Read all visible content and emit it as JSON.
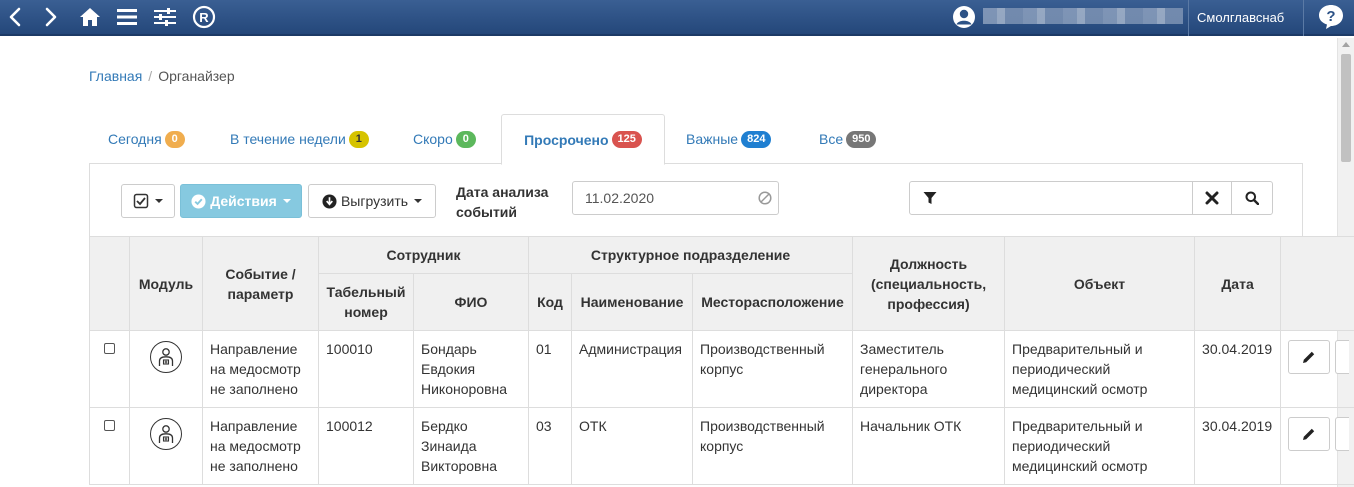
{
  "topbar": {
    "icons": [
      "back-arrow-icon",
      "forward-arrow-icon",
      "home-icon",
      "menu-icon",
      "settings-sliders-icon",
      "registered-icon",
      "user-icon",
      "help-icon"
    ],
    "org_name": "Смолглавснаб",
    "help_label": "?"
  },
  "breadcrumb": {
    "home": "Главная",
    "separator": "/",
    "current": "Органайзер"
  },
  "tabs": [
    {
      "label": "Сегодня",
      "count": "0",
      "color": "#f0ad4e"
    },
    {
      "label": "В течение недели",
      "count": "1",
      "color": "#d6c300"
    },
    {
      "label": "Скоро",
      "count": "0",
      "color": "#5cb85c"
    },
    {
      "label": "Просрочено",
      "count": "125",
      "color": "#d9534f",
      "active": true
    },
    {
      "label": "Важные",
      "count": "824",
      "color": "#1f7fd1"
    },
    {
      "label": "Все",
      "count": "950",
      "color": "#777777"
    }
  ],
  "toolbar": {
    "actions_label": "Действия",
    "export_label": "Выгрузить",
    "date_label_line1": "Дата анализа",
    "date_label_line2": "событий",
    "date_value": "11.02.2020",
    "search_value": ""
  },
  "table": {
    "headers": {
      "module": "Модуль",
      "event": "Событие / параметр",
      "employee": "Сотрудник",
      "tab_number": "Табельный номер",
      "fio": "ФИО",
      "division": "Структурное подразделение",
      "code": "Код",
      "name": "Наименование",
      "location": "Месторасположение",
      "position": "Должность (специальность, профессия)",
      "object": "Объект",
      "date": "Дата"
    },
    "rows": [
      {
        "event": "Направление на медосмотр не заполнено",
        "tab_number": "100010",
        "fio": "Бондарь Евдокия Никоноровна",
        "code": "01",
        "name": "Администрация",
        "location": "Производственный корпус",
        "position": "Заместитель генерального директора",
        "object": "Предварительный и периодический медицинский осмотр",
        "date": "30.04.2019"
      },
      {
        "event": "Направление на медосмотр не заполнено",
        "tab_number": "100012",
        "fio": "Бердко Зинаида Викторовна",
        "code": "03",
        "name": "ОТК",
        "location": "Производственный корпус",
        "position": "Начальник ОТК",
        "object": "Предварительный и периодический медицинский осмотр",
        "date": "30.04.2019"
      }
    ]
  }
}
